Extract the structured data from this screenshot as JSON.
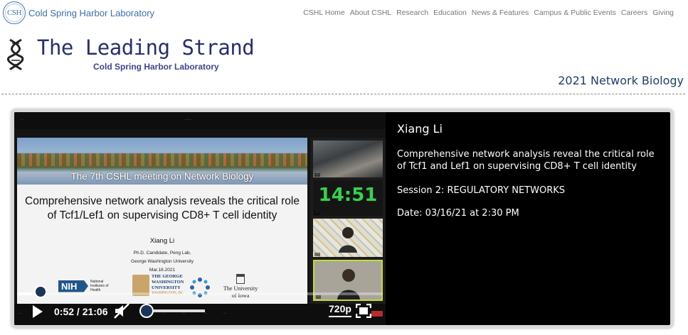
{
  "site": {
    "logo_mark": "CSH",
    "logo_text": "Cold Spring Harbor Laboratory"
  },
  "topnav": {
    "items": [
      "CSHL Home",
      "About CSHL",
      "Research",
      "Education",
      "News & Features",
      "Campus & Public Events",
      "Careers",
      "Giving"
    ]
  },
  "header": {
    "title": "The Leading Strand",
    "subtitle": "Cold Spring Harbor Laboratory",
    "section": "2021 Network Biology"
  },
  "player": {
    "slide": {
      "meeting": "The 7th CSHL meeting on Network Biology",
      "title": "Comprehensive network analysis reveals the critical role of Tcf1/Lef1 on supervising CD8+ T cell identity",
      "author": "Xiang Li",
      "affiliation_lines": [
        "Ph.D. Candidate, Peng Lab,",
        "George Washington University",
        "Mar.16.2021"
      ],
      "logo_nih": "NIH",
      "logo_nih_text": "National Institutes of Health",
      "logo_gwu_lines": [
        "THE GEORGE",
        "WASHINGTON",
        "UNIVERSITY"
      ],
      "logo_gwu_city": "WASHINGTON, DC",
      "logo_iowa_lines": [
        "The University",
        "of Iowa"
      ]
    },
    "timer": "14:51",
    "current_time": "0:52",
    "duration": "21:06",
    "timecode": "0:52 / 21:06",
    "progress_fraction": 0.041,
    "volume_fraction": 0.0,
    "quality": "720p"
  },
  "talk": {
    "speaker": "Xiang Li",
    "title": "Comprehensive network analysis reveal the critical role of Tcf1 and Lef1 on supervising CD8+ T cell identity",
    "session": "Session 2: REGULATORY NETWORKS",
    "date": "Date: 03/16/21 at 2:30 PM"
  },
  "colors": {
    "brand_navy": "#2a2e6b",
    "timer_green": "#38d04c",
    "knob_blue": "#1a3558",
    "link_blue": "#3c6fa6"
  }
}
